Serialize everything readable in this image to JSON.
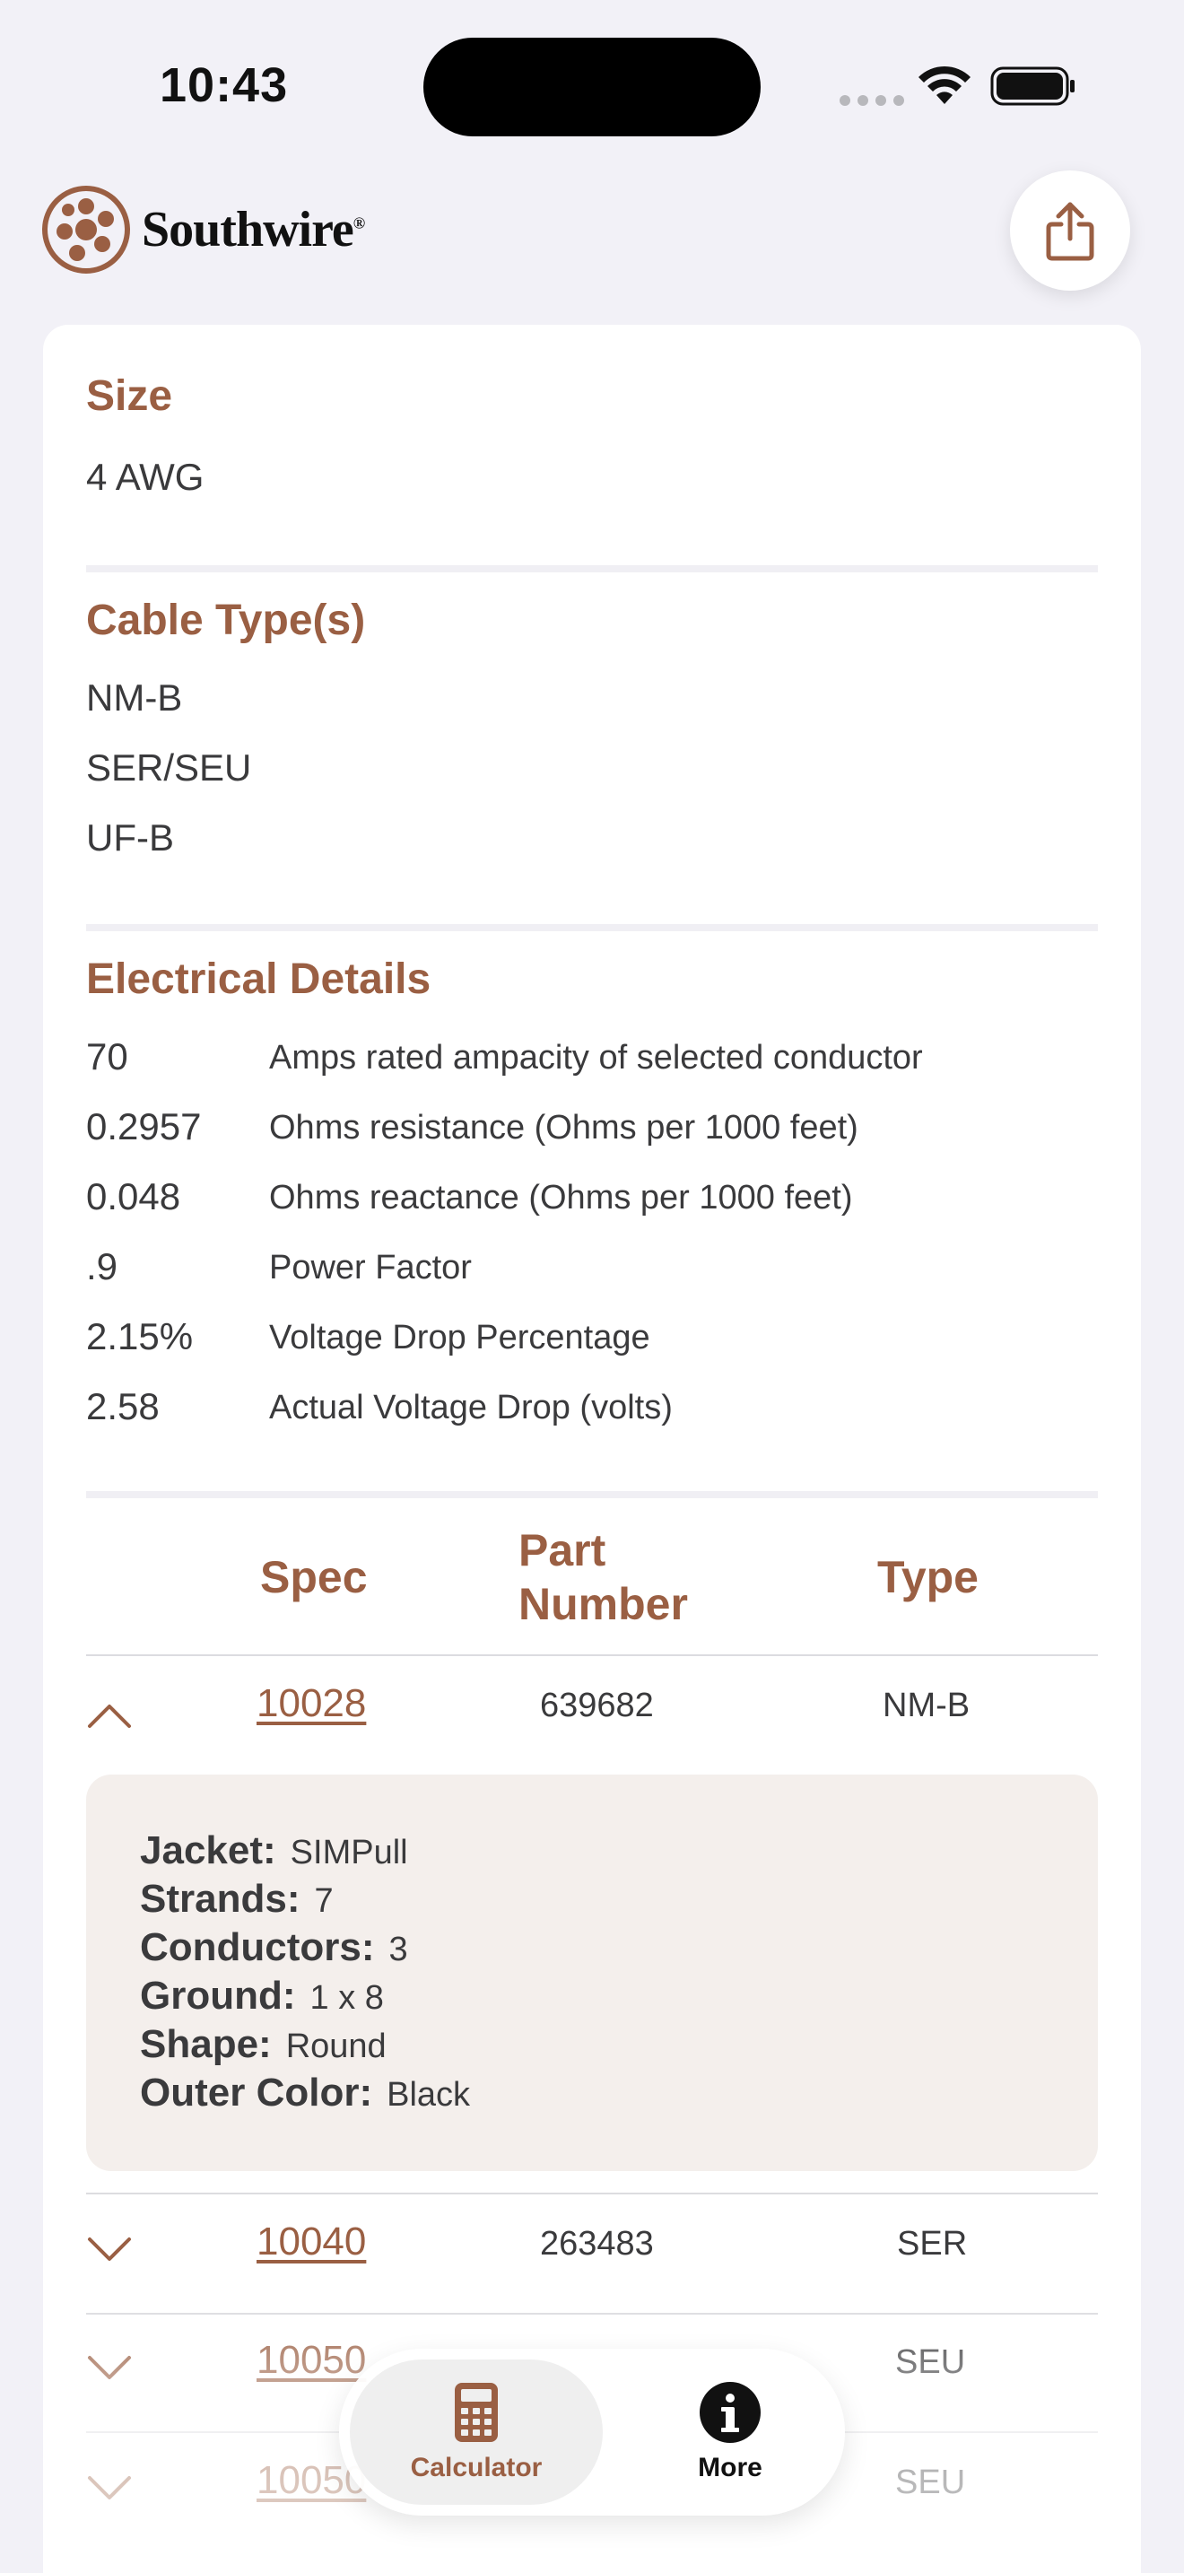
{
  "status": {
    "time": "10:43"
  },
  "header": {
    "logo_text": "Southwire",
    "logo_mark": "®",
    "share_icon": "share-icon"
  },
  "size": {
    "title": "Size",
    "value": "4 AWG"
  },
  "cable_types": {
    "title": "Cable Type(s)",
    "items": [
      "NM-B",
      "SER/SEU",
      "UF-B"
    ]
  },
  "electrical": {
    "title": "Electrical Details",
    "rows": [
      {
        "value": "70",
        "label": "Amps rated ampacity of selected conductor"
      },
      {
        "value": "0.2957",
        "label": "Ohms resistance (Ohms per 1000 feet)"
      },
      {
        "value": "0.048",
        "label": "Ohms reactance (Ohms per 1000 feet)"
      },
      {
        "value": ".9",
        "label": "Power Factor"
      },
      {
        "value": "2.15%",
        "label": "Voltage Drop Percentage"
      },
      {
        "value": "2.58",
        "label": "Actual Voltage Drop (volts)"
      }
    ]
  },
  "table": {
    "headers": {
      "spec": "Spec",
      "part_line1": "Part",
      "part_line2": "Number",
      "type": "Type"
    },
    "rows": [
      {
        "spec": "10028",
        "part": "639682",
        "type": "NM-B",
        "expanded": true
      },
      {
        "spec": "10040",
        "part": "263483",
        "type": "SER",
        "expanded": false
      },
      {
        "spec": "10050",
        "part": "",
        "type": "SEU",
        "expanded": false
      },
      {
        "spec": "10050",
        "part": "",
        "type": "SEU",
        "expanded": false
      }
    ],
    "expanded_details": [
      {
        "key": "Jacket:",
        "value": "SIMPull"
      },
      {
        "key": "Strands:",
        "value": "7"
      },
      {
        "key": "Conductors:",
        "value": "3"
      },
      {
        "key": "Ground:",
        "value": "1 x 8"
      },
      {
        "key": "Shape:",
        "value": "Round"
      },
      {
        "key": "Outer Color:",
        "value": "Black"
      }
    ]
  },
  "tabbar": {
    "tabs": [
      {
        "label": "Calculator",
        "icon": "calculator-icon",
        "active": true
      },
      {
        "label": "More",
        "icon": "info-icon",
        "active": false
      }
    ]
  },
  "colors": {
    "accent": "#9a5f43",
    "background": "#f2f1f7",
    "panel": "#f4efec"
  }
}
